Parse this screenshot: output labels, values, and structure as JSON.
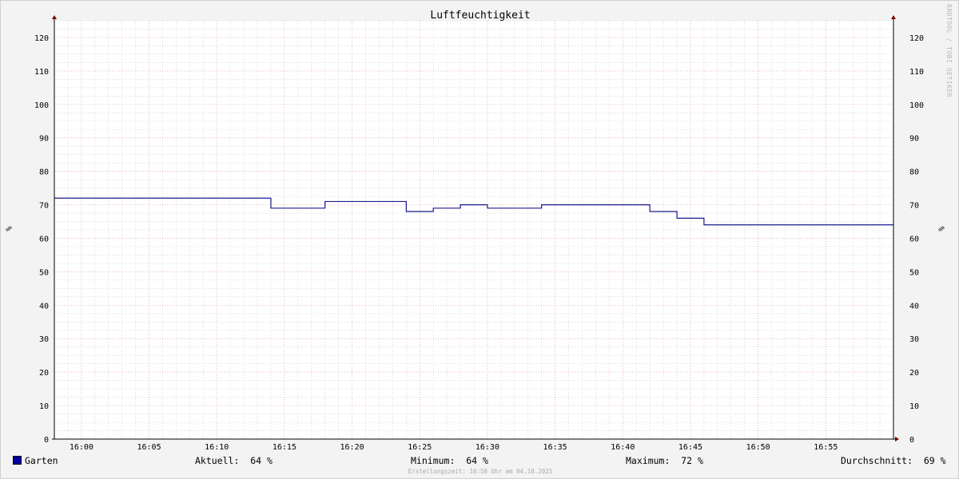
{
  "chart_data": {
    "type": "line",
    "title": "Luftfeuchtigkeit",
    "ylabel": "%",
    "ylabel_right": "%",
    "ylim": [
      0,
      125
    ],
    "y_ticks": [
      0,
      10,
      20,
      30,
      40,
      50,
      60,
      70,
      80,
      90,
      100,
      110,
      120
    ],
    "x_range": [
      "15:58",
      "17:00"
    ],
    "x_ticks": [
      "16:00",
      "16:05",
      "16:10",
      "16:15",
      "16:20",
      "16:25",
      "16:30",
      "16:35",
      "16:40",
      "16:45",
      "16:50",
      "16:55"
    ],
    "grid": true,
    "series": [
      {
        "name": "Garten",
        "color": "#000080",
        "step": true,
        "points": [
          {
            "x": "15:58",
            "y": 72
          },
          {
            "x": "16:14",
            "y": 69
          },
          {
            "x": "16:18",
            "y": 71
          },
          {
            "x": "16:24",
            "y": 68
          },
          {
            "x": "16:26",
            "y": 69
          },
          {
            "x": "16:28",
            "y": 70
          },
          {
            "x": "16:30",
            "y": 69
          },
          {
            "x": "16:34",
            "y": 70
          },
          {
            "x": "16:42",
            "y": 68
          },
          {
            "x": "16:44",
            "y": 66
          },
          {
            "x": "16:46",
            "y": 64
          },
          {
            "x": "17:00",
            "y": 64
          }
        ]
      }
    ]
  },
  "colors": {
    "background": "#f3f3f3",
    "plot_area": "#ffffff",
    "major_grid": "#e0a0a8",
    "minor_grid": "#c8c8c8",
    "axis": "#000000",
    "arrow": "#800000",
    "series": "#000080"
  },
  "watermark": "RRDTOOL / TOBI OETIKER",
  "legend": {
    "series_name": "Garten",
    "aktuell": "Aktuell:  64 %",
    "minimum": "Minimum:  64 %",
    "maximum": "Maximum:  72 %",
    "durchschnitt": "Durchschnitt:  69 %"
  },
  "footer": "Erstellungszeit: 16:58 Uhr am 04.10.2025"
}
